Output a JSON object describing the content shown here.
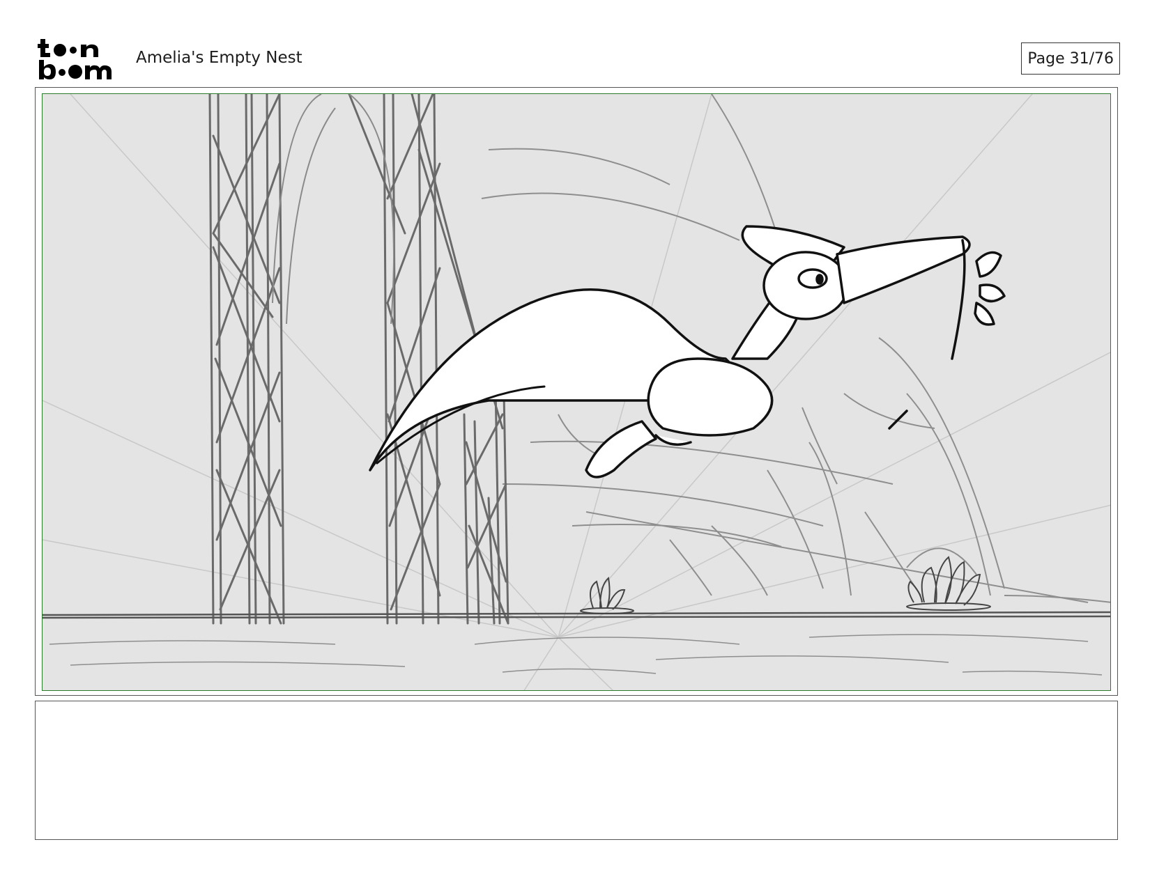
{
  "header": {
    "logo_text_top": "toon",
    "logo_text_bottom": "boom",
    "title": "Amelia's Empty Nest",
    "page_label": "Page 31/76"
  },
  "panel": {
    "frame_color": "#2a7a2a",
    "background_color": "#e4e4e4"
  },
  "notes": {
    "text": ""
  }
}
